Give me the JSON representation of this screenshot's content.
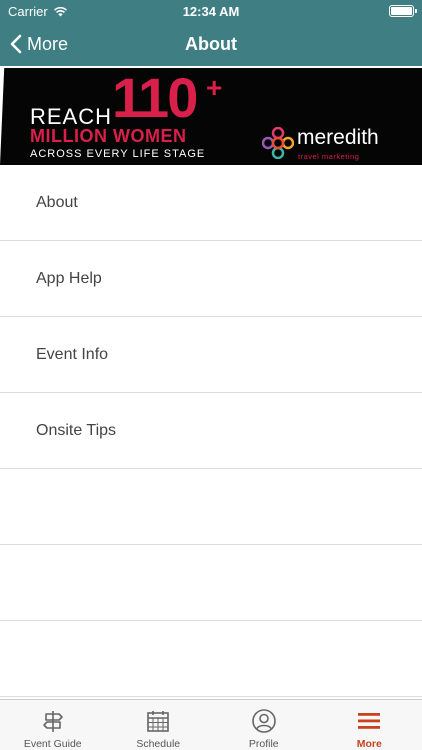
{
  "status_bar": {
    "carrier": "Carrier",
    "time": "12:34 AM"
  },
  "nav": {
    "back_label": "More",
    "title": "About"
  },
  "banner": {
    "reach": "REACH",
    "number": "110",
    "plus": "+",
    "million": "MILLION WOMEN",
    "across": "ACROSS EVERY LIFE STAGE",
    "brand": "meredith",
    "sub": "travel marketing"
  },
  "menu": {
    "items": [
      {
        "label": "About"
      },
      {
        "label": "App Help"
      },
      {
        "label": "Event Info"
      },
      {
        "label": "Onsite Tips"
      }
    ]
  },
  "tabbar": {
    "tabs": [
      {
        "label": "Event Guide",
        "icon": "signpost-icon"
      },
      {
        "label": "Schedule",
        "icon": "calendar-icon"
      },
      {
        "label": "Profile",
        "icon": "user-icon"
      },
      {
        "label": "More",
        "icon": "menu-icon"
      }
    ],
    "active": "More"
  },
  "colors": {
    "header": "#3f7f84",
    "accent": "#c8421e",
    "banner_red": "#d8204a"
  }
}
